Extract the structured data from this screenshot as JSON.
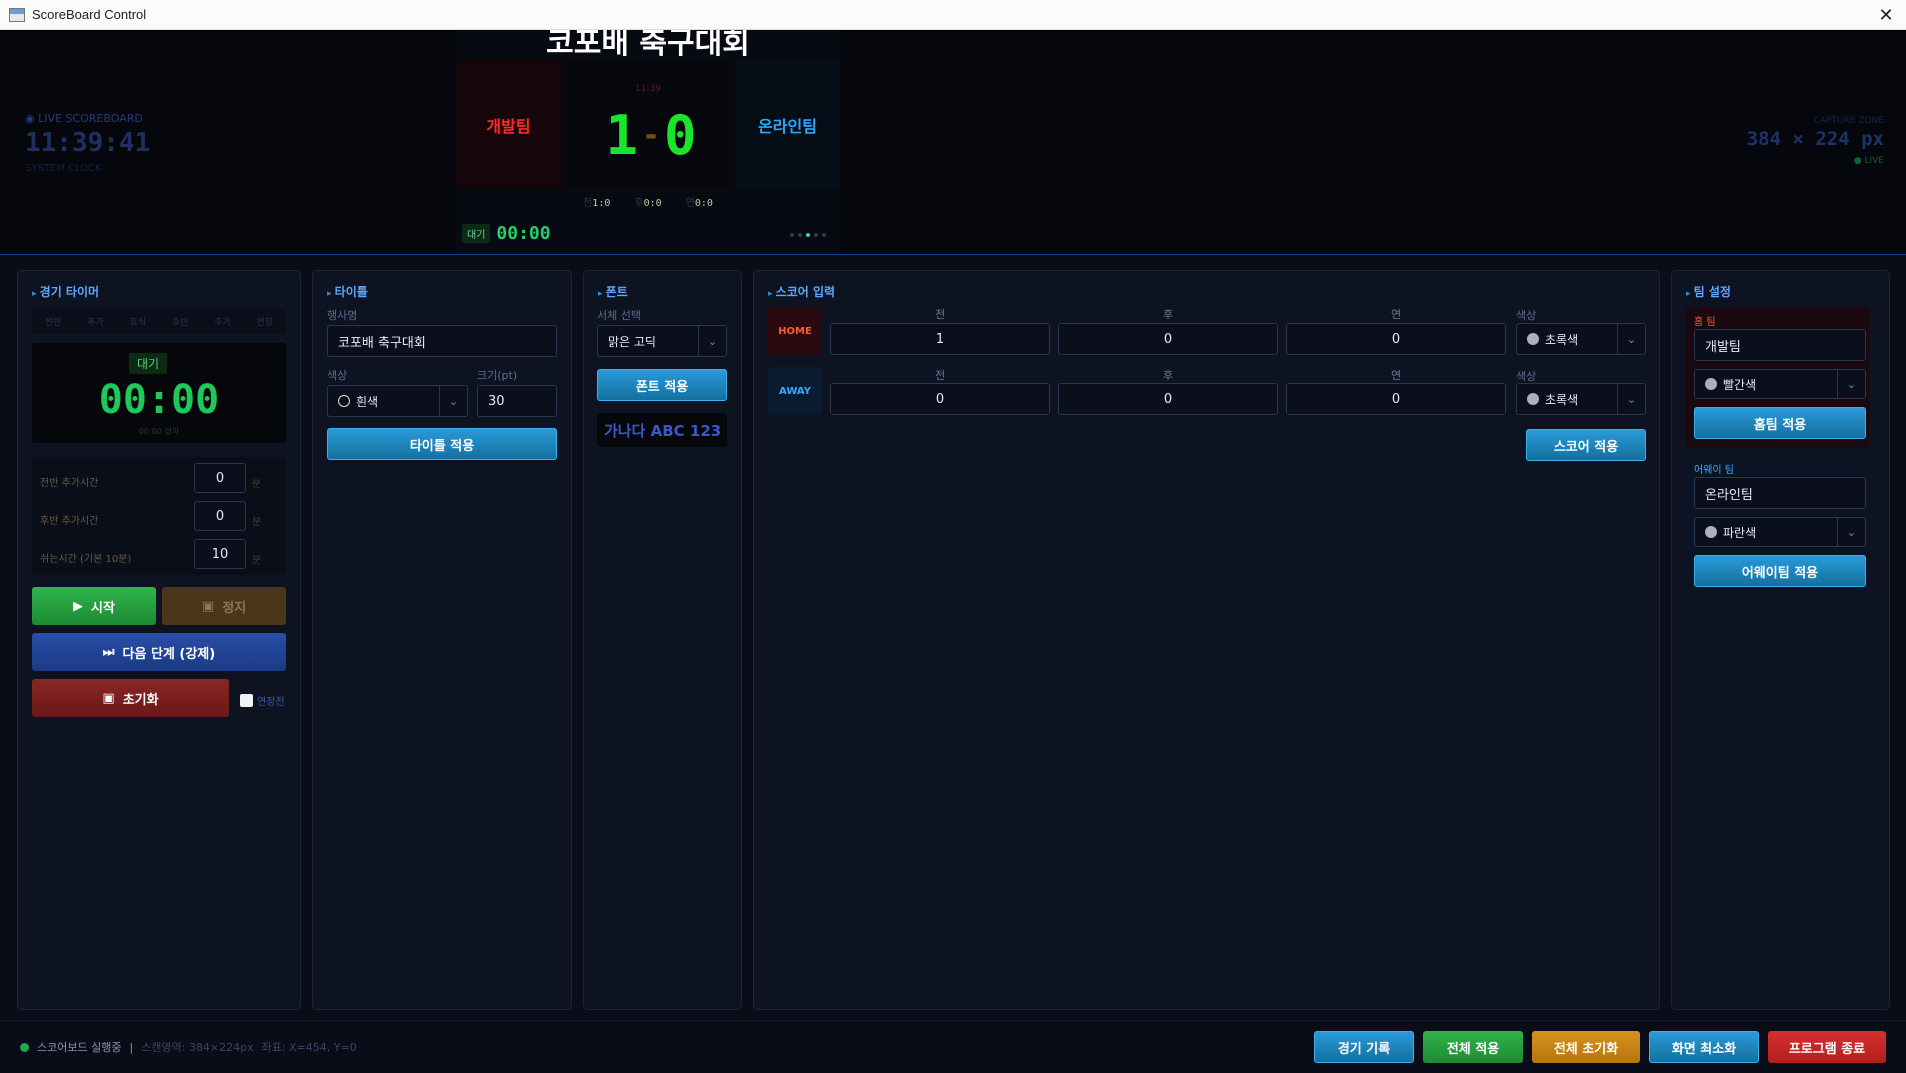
{
  "window": {
    "title": "ScoreBoard Control",
    "close_glyph": "✕"
  },
  "live": {
    "label": "◉ LIVE SCOREBOARD",
    "clock": "11:39:41",
    "sub": "SYSTEM CLOCK"
  },
  "capture": {
    "label": "CAPTURE ZONE",
    "size": "384 × 224 px",
    "live": "● LIVE"
  },
  "scoreboard": {
    "title": "코포배 축구대회",
    "home_name": "개발팀",
    "away_name": "온라인팀",
    "center_time": "11:39",
    "home_score": "1",
    "dash": "-",
    "away_score": "0",
    "periods": [
      {
        "tag": "전",
        "score": "1:0"
      },
      {
        "tag": "후",
        "score": "0:0"
      },
      {
        "tag": "연",
        "score": "0:0"
      }
    ],
    "state": "대기",
    "timer": "00:00"
  },
  "timer_panel": {
    "heading": "경기 타이머",
    "tabs": [
      "전반",
      "추가",
      "휴식",
      "후반",
      "추가",
      "연장"
    ],
    "state": "대기",
    "time": "00:00",
    "sub": "00:00 경과",
    "extras": [
      {
        "label": "전반 추가시간",
        "value": "0",
        "unit": "분"
      },
      {
        "label": "후반 추가시간",
        "value": "0",
        "unit": "분"
      },
      {
        "label": "쉬는시간 (기본 10분)",
        "value": "10",
        "unit": "분"
      }
    ],
    "start": "시작",
    "stop": "정지",
    "next": "다음 단계 (강제)",
    "reset": "초기화",
    "overtime": "연장전"
  },
  "title_panel": {
    "heading": "타이틀",
    "event_label": "행사명",
    "event_value": "코포배 축구대회",
    "color_label": "색상",
    "color_value": "흰색",
    "size_label": "크기(pt)",
    "size_value": "30",
    "apply": "타이틀 적용"
  },
  "font_panel": {
    "heading": "폰트",
    "select_label": "서체 선택",
    "font_value": "맑은 고딕",
    "apply": "폰트 적용",
    "preview": "가나다 ABC 123"
  },
  "score_panel": {
    "heading": "스코어 입력",
    "columns": [
      "전",
      "후",
      "연",
      "색상"
    ],
    "home": {
      "tag": "HOME",
      "values": [
        "1",
        "0",
        "0"
      ],
      "color": "초록색"
    },
    "away": {
      "tag": "AWAY",
      "values": [
        "0",
        "0",
        "0"
      ],
      "color": "초록색"
    },
    "apply": "스코어 적용"
  },
  "team_panel": {
    "heading": "팀 설정",
    "home_label": "홈 팀",
    "home_name": "개발팀",
    "home_color": "빨간색",
    "home_apply": "홈팀 적용",
    "away_label": "어웨이 팀",
    "away_name": "온라인팀",
    "away_color": "파란색",
    "away_apply": "어웨이팀 적용"
  },
  "status": {
    "state": "스코어보드 실행중",
    "sep": "|",
    "screen": "스캔영역: 384×224px",
    "coords": "좌표: X=454, Y=0"
  },
  "actions": [
    "경기 기록",
    "전체 적용",
    "전체 초기화",
    "화면 최소화",
    "프로그램 종료"
  ],
  "colors": {
    "accent": "#2a9ad8",
    "score_green": "#19e62a",
    "home_red": "#ff2a2a",
    "away_blue": "#2aa8ff"
  }
}
